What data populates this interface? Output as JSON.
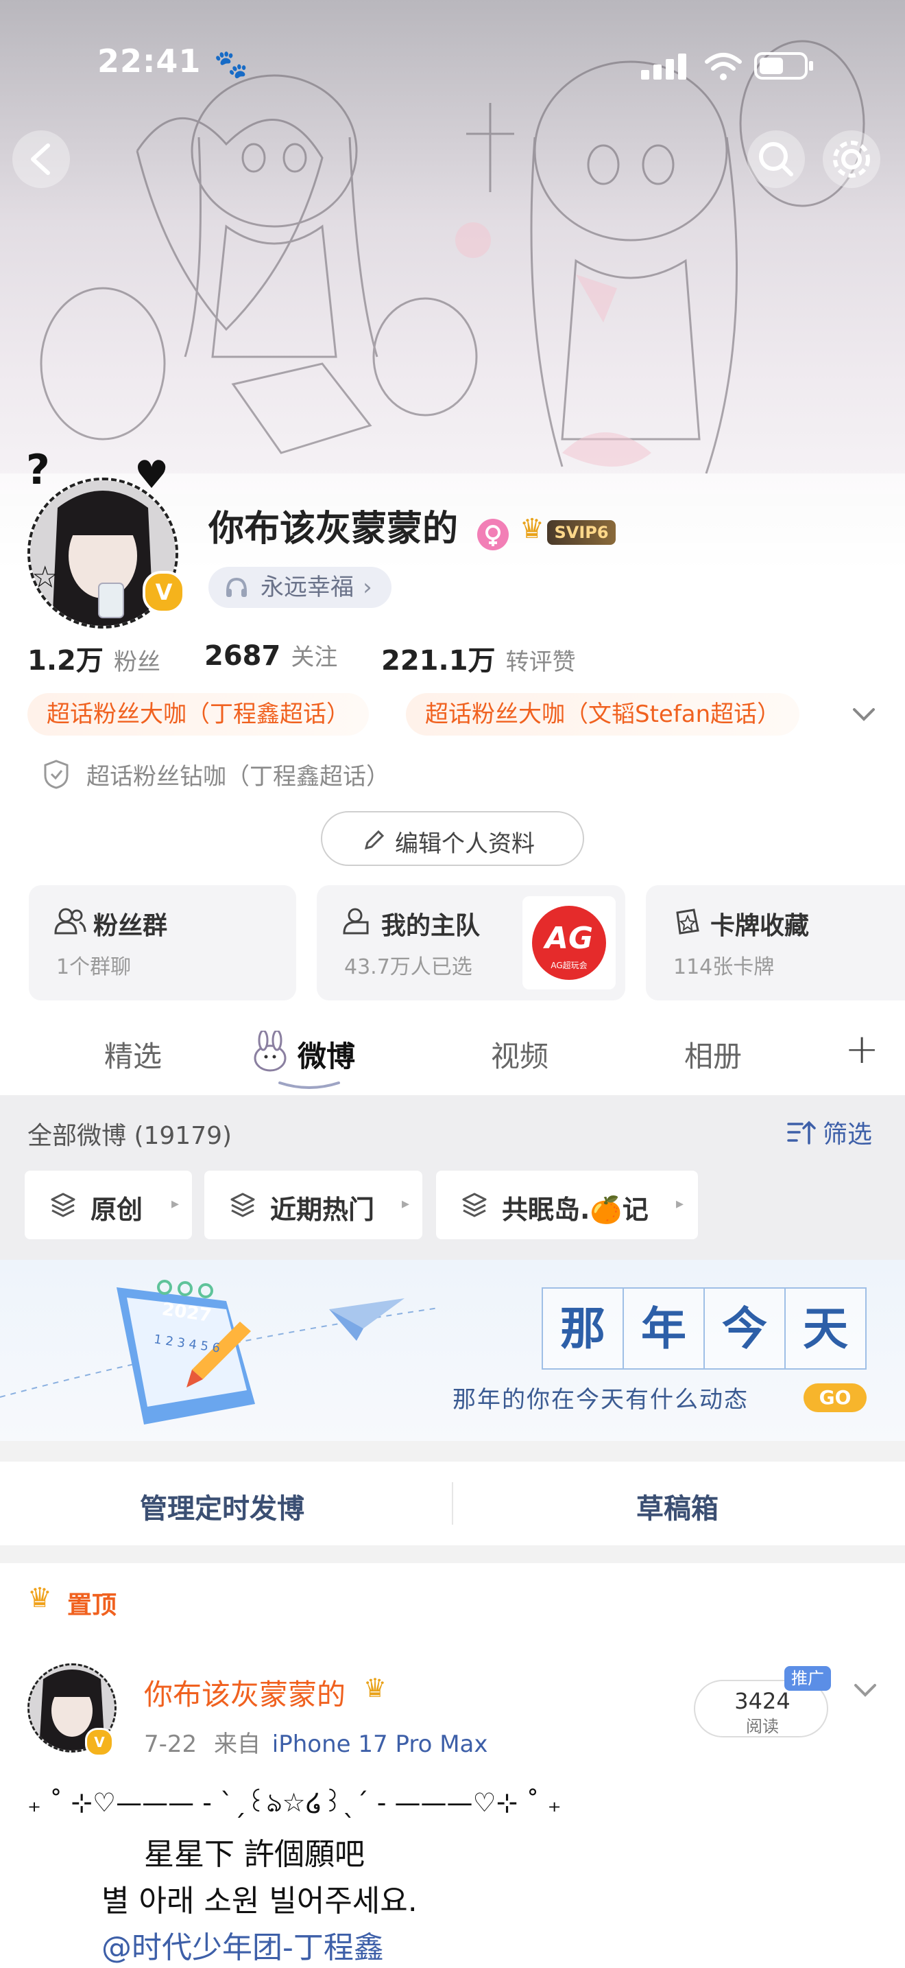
{
  "status_bar": {
    "time": "22:41"
  },
  "profile": {
    "name": "你布该灰蒙蒙的",
    "vip_badge": "SVIP6",
    "verified_mark": "V",
    "signature": "永远幸福",
    "signature_arrow": "›",
    "stats": [
      {
        "value": "1.2万",
        "label": "粉丝"
      },
      {
        "value": "2687",
        "label": "关注"
      },
      {
        "value": "221.1万",
        "label": "转评赞"
      }
    ],
    "supertag_1": "超话粉丝大咖（丁程鑫超话）",
    "supertag_2": "超话粉丝大咖（文韬Stefan超话）",
    "supertag_3": "超话粉丝钻咖（丁程鑫超话）",
    "edit_button": "编辑个人资料"
  },
  "feature_cards": {
    "fans_group": {
      "title": "粉丝群",
      "sub": "1个群聊"
    },
    "home_team": {
      "title": "我的主队",
      "sub": "43.7万人已选",
      "logo_text": "AG",
      "logo_sub": "AG超玩会"
    },
    "card_collection": {
      "title": "卡牌收藏",
      "sub": "114张卡牌"
    }
  },
  "tabs": [
    {
      "label": "精选"
    },
    {
      "label": "微博"
    },
    {
      "label": "视频"
    },
    {
      "label": "相册"
    }
  ],
  "tabs_add": "+",
  "filter": {
    "title": "全部微博 (19179)",
    "filter_label": "筛选",
    "chips": [
      {
        "label": "原创"
      },
      {
        "label": "近期热门"
      },
      {
        "label": "共眠岛.🍊记"
      }
    ],
    "chip_arrow": "▸"
  },
  "anniversary": {
    "chars": [
      "那",
      "年",
      "今",
      "天"
    ],
    "subtitle": "那年的你在今天有什么动态",
    "go_label": "GO",
    "calendar_year": "2027",
    "calendar_digits": "1 2 3 4 5 6"
  },
  "actions": {
    "scheduled": "管理定时发博",
    "drafts": "草稿箱"
  },
  "pinned_label": "置顶",
  "post": {
    "author": "你布该灰蒙蒙的",
    "date": "7-22",
    "source_prefix": "来自",
    "source": "iPhone 17 Pro Max",
    "read_count": "3424",
    "read_label": "阅读",
    "promo_tag": "推广",
    "lines": [
      "₊ ˚ ⊹♡——— - ˋˏ꒰ঌ☆໒꒱ˎˊ - ———♡⊹ ˚ ₊",
      "星星下 許個願吧",
      "별 아래 소원 빌어주세요.",
      "@时代少年团-丁程鑫"
    ]
  },
  "colors": {
    "accent_orange": "#f0611f",
    "link_blue": "#3d5fa8",
    "vip_gold": "#e9a21a"
  }
}
